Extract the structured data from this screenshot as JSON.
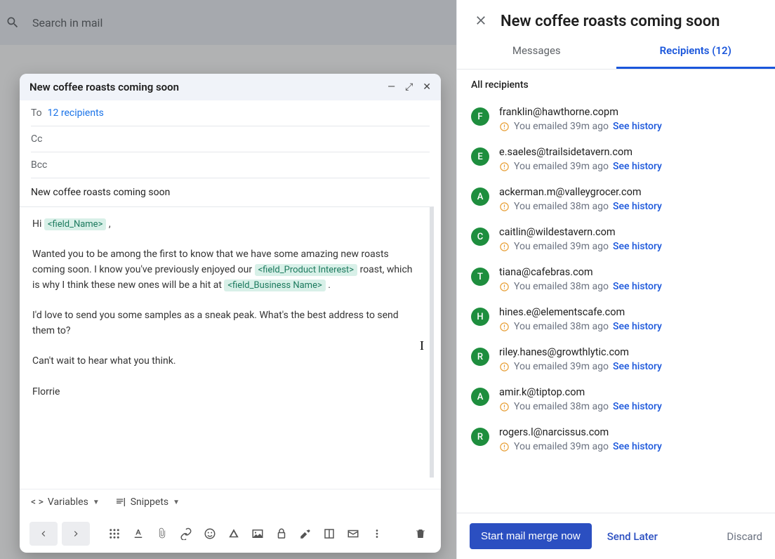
{
  "search": {
    "placeholder": "Search in mail"
  },
  "compose": {
    "title": "New coffee roasts coming soon",
    "to_label": "To",
    "recipients_link": "12 recipients",
    "cc_label": "Cc",
    "bcc_label": "Bcc",
    "subject": "New coffee roasts coming soon",
    "body": {
      "greeting_prefix": "Hi ",
      "field_name": "<field_Name>",
      "greeting_suffix": " ,",
      "p1_a": "Wanted you to be among the first to know that we have some amazing new roasts coming soon. I know you've previously enjoyed our ",
      "field_product": "<field_Product Interest>",
      "p1_b": " roast, which is why I think these new ones will be a hit at ",
      "field_business": "<field_Business Name>",
      "p1_c": " .",
      "p2": "I'd love to send you some samples as a sneak peak. What's the best address to send them to?",
      "p3": "Can't wait to hear what you think.",
      "signature": "Florrie"
    },
    "variables_label": "Variables",
    "snippets_label": "Snippets"
  },
  "panel": {
    "title": "New coffee roasts coming soon",
    "tab_messages": "Messages",
    "tab_recipients": "Recipients (12)",
    "all_recipients": "All recipients",
    "see_history": "See history",
    "footer": {
      "start": "Start mail merge now",
      "later": "Send Later",
      "discard": "Discard"
    },
    "recipients": [
      {
        "initial": "F",
        "color": "#1e8e3e",
        "email": "franklin@hawthorne.copm",
        "status": "You emailed 39m ago"
      },
      {
        "initial": "E",
        "color": "#1e8e3e",
        "email": "e.saeles@trailsidetavern.com",
        "status": "You emailed 39m ago"
      },
      {
        "initial": "A",
        "color": "#1e8e3e",
        "email": "ackerman.m@valleygrocer.com",
        "status": "You emailed 38m ago"
      },
      {
        "initial": "C",
        "color": "#1e8e3e",
        "email": "caitlin@wildestavern.com",
        "status": "You emailed 39m ago"
      },
      {
        "initial": "T",
        "color": "#1e8e3e",
        "email": "tiana@cafebras.com",
        "status": "You emailed 38m ago"
      },
      {
        "initial": "H",
        "color": "#1e8e3e",
        "email": "hines.e@elementscafe.com",
        "status": "You emailed 38m ago"
      },
      {
        "initial": "R",
        "color": "#1e8e3e",
        "email": "riley.hanes@growthlytic.com",
        "status": "You emailed 39m ago"
      },
      {
        "initial": "A",
        "color": "#1e8e3e",
        "email": "amir.k@tiptop.com",
        "status": "You emailed 38m ago"
      },
      {
        "initial": "R",
        "color": "#1e8e3e",
        "email": "rogers.l@narcissus.com",
        "status": "You emailed 39m ago"
      }
    ]
  }
}
